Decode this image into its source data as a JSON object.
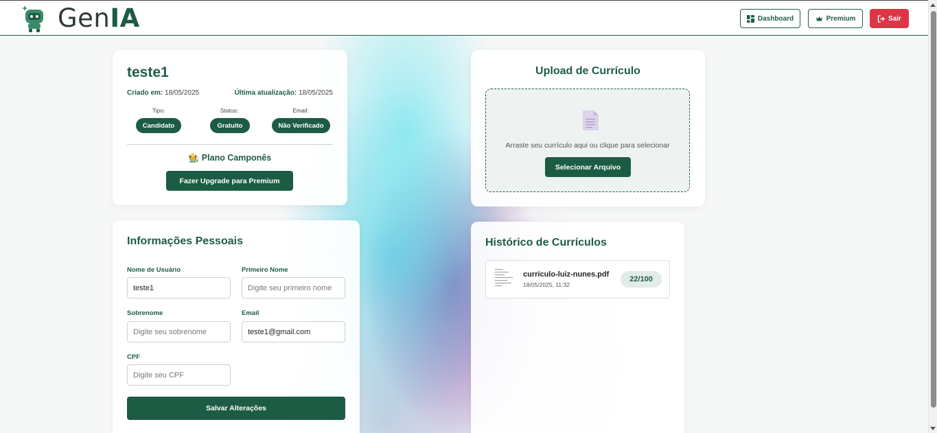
{
  "header": {
    "brand_prefix": "Gen",
    "brand_suffix": "IA",
    "buttons": {
      "dashboard": "Dashboard",
      "premium": "Premium",
      "logout": "Sair"
    }
  },
  "profile": {
    "username": "teste1",
    "created_label": "Criado em:",
    "created_value": "18/05/2025",
    "updated_label": "Última atualização:",
    "updated_value": "18/05/2025",
    "type_label": "Tipo:",
    "type_value": "Candidato",
    "status_label": "Status:",
    "status_value": "Gratuito",
    "email_label": "Email:",
    "email_value": "Não Verificado",
    "plan": "🧑‍🌾 Plano Camponês",
    "upgrade_button": "Fazer Upgrade para Premium"
  },
  "personal_info": {
    "title": "Informações Pessoais",
    "username_label": "Nome de Usuário",
    "username_value": "teste1",
    "first_name_label": "Primeiro Nome",
    "first_name_placeholder": "Digite seu primeiro nome",
    "last_name_label": "Sobrenome",
    "last_name_placeholder": "Digite seu sobrenome",
    "email_label": "Email",
    "email_value": "teste1@gmail.com",
    "cpf_label": "CPF",
    "cpf_placeholder": "Digite seu CPF",
    "save_button": "Salvar Alterações"
  },
  "upload": {
    "title": "Upload de Currículo",
    "instruction": "Arraste seu currículo aqui ou clique para selecionar",
    "select_button": "Selecionar Arquivo"
  },
  "history": {
    "title": "Histórico de Currículos",
    "items": [
      {
        "filename": "curriculo-luiz-nunes.pdf",
        "date": "18/05/2025, 11:32",
        "score": "22/100"
      }
    ]
  },
  "colors": {
    "primary": "#1d5c44",
    "danger": "#dc3545"
  }
}
